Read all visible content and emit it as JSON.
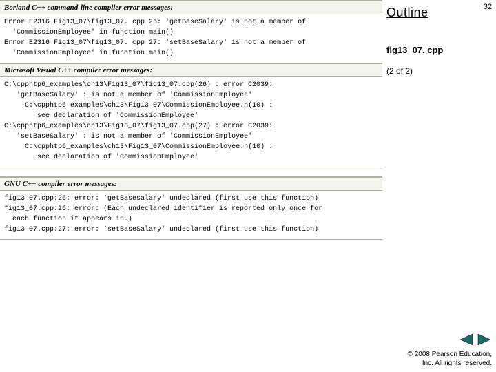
{
  "sidebar": {
    "title": "Outline",
    "slide_number": "32",
    "filename": "fig13_07. cpp",
    "page_of": "(2 of 2)"
  },
  "sections": [
    {
      "header": "Borland C++ command-line compiler error messages:",
      "body": "Error E2316 Fig13_07\\fig13_07. cpp 26: 'getBaseSalary' is not a member of\n  'CommissionEmployee' in function main()\nError E2316 Fig13_07\\fig13_07. cpp 27: 'setBaseSalary' is not a member of\n  'CommissionEmployee' in function main()"
    },
    {
      "header": "Microsoft Visual C++ compiler error messages:",
      "body": "C:\\cpphtp6_examples\\ch13\\Fig13_07\\fig13_07.cpp(26) : error C2039:\n   'getBaseSalary' : is not a member of 'CommissionEmployee'\n     C:\\cpphtp6_examples\\ch13\\Fig13_07\\CommissionEmployee.h(10) :\n        see declaration of 'CommissionEmployee'\nC:\\cpphtp6_examples\\ch13\\Fig13_07\\fig13_07.cpp(27) : error C2039:\n   'setBaseSalary' : is not a member of 'CommissionEmployee'\n     C:\\cpphtp6_examples\\ch13\\Fig13_07\\CommissionEmployee.h(10) :\n        see declaration of 'CommissionEmployee'"
    },
    {
      "header": "GNU C++ compiler error messages:",
      "body": "fig13_07.cpp:26: error: `getBasesalary' undeclared (first use this function)\nfig13_07.cpp:26: error: (Each undeclared identifier is reported only once for\n  each function it appears in.)\nfig13_07.cpp:27: error: `setBaseSalary' undeclared (first use this function)"
    }
  ],
  "footer": {
    "copyright_line1": "© 2008 Pearson Education,",
    "copyright_line2": "Inc.  All rights reserved."
  }
}
